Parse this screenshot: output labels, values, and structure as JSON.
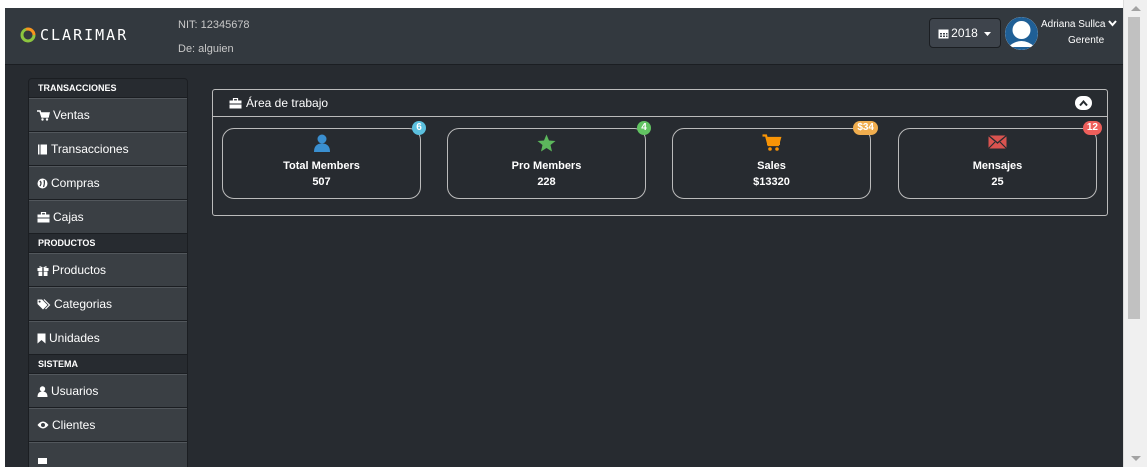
{
  "header": {
    "brand": "CLARIMAR",
    "nit": "NIT: 12345678",
    "de": "De: alguien",
    "year": "2018",
    "user_name": "Adriana Sullca",
    "user_role": "Gerente"
  },
  "sidebar": {
    "sections": [
      {
        "title": "TRANSACCIONES",
        "items": [
          "Ventas",
          "Transacciones",
          "Compras",
          "Cajas"
        ]
      },
      {
        "title": "PRODUCTOS",
        "items": [
          "Productos",
          "Categorias",
          "Unidades"
        ]
      },
      {
        "title": "SISTEMA",
        "items": [
          "Usuarios",
          "Clientes"
        ]
      }
    ]
  },
  "panel": {
    "title": "Área de trabajo",
    "cards": [
      {
        "title": "Total Members",
        "value": "507",
        "badge": "6",
        "badge_color": "#5bc0de",
        "icon": "user-icon",
        "icon_color": "#3a8fd0"
      },
      {
        "title": "Pro Members",
        "value": "228",
        "badge": "4",
        "badge_color": "#62c462",
        "icon": "star-icon",
        "icon_color": "#5cb85c"
      },
      {
        "title": "Sales",
        "value": "$13320",
        "badge": "$34",
        "badge_color": "#f0ad4e",
        "icon": "cart-icon",
        "icon_color": "#f89406"
      },
      {
        "title": "Mensajes",
        "value": "25",
        "badge": "12",
        "badge_color": "#ee5f5b",
        "icon": "envelope-icon",
        "icon_color": "#d9534f"
      }
    ]
  },
  "colors": {
    "background": "#272b30",
    "navbar": "#33393f",
    "sidebar_item": "#3a3f44",
    "logo_green": "#8dc63f",
    "logo_orange": "#f7941d"
  }
}
